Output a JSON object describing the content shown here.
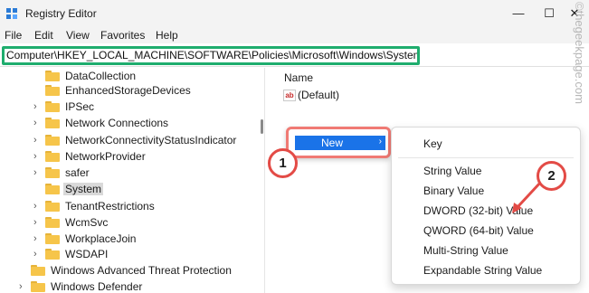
{
  "window": {
    "title": "Registry Editor",
    "controls": {
      "minimize": "—",
      "maximize": "☐",
      "close": "✕"
    }
  },
  "menu": [
    "File",
    "Edit",
    "View",
    "Favorites",
    "Help"
  ],
  "address": {
    "path": "Computer\\HKEY_LOCAL_MACHINE\\SOFTWARE\\Policies\\Microsoft\\Windows\\System"
  },
  "tree": {
    "items": [
      {
        "label": "DataCollection",
        "expandable": false
      },
      {
        "label": "EnhancedStorageDevices",
        "expandable": false
      },
      {
        "label": "IPSec",
        "expandable": true
      },
      {
        "label": "Network Connections",
        "expandable": true
      },
      {
        "label": "NetworkConnectivityStatusIndicator",
        "expandable": true
      },
      {
        "label": "NetworkProvider",
        "expandable": true
      },
      {
        "label": "safer",
        "expandable": true
      },
      {
        "label": "System",
        "expandable": false,
        "selected": true
      },
      {
        "label": "TenantRestrictions",
        "expandable": true
      },
      {
        "label": "WcmSvc",
        "expandable": true
      },
      {
        "label": "WorkplaceJoin",
        "expandable": true
      },
      {
        "label": "WSDAPI",
        "expandable": true
      }
    ],
    "parent_items": [
      {
        "label": "Windows Advanced Threat Protection",
        "expandable": false
      },
      {
        "label": "Windows Defender",
        "expandable": true
      }
    ]
  },
  "values_pane": {
    "column_name": "Name",
    "rows": [
      {
        "icon": "string-value-icon",
        "icon_text": "ab",
        "name": "(Default)"
      }
    ]
  },
  "context_menu": {
    "new_item": {
      "label": "New",
      "arrow": "›"
    },
    "submenu": {
      "key": "Key",
      "items": [
        "String Value",
        "Binary Value",
        "DWORD (32-bit) Value",
        "QWORD (64-bit) Value",
        "Multi-String Value",
        "Expandable String Value"
      ]
    }
  },
  "callouts": [
    "1",
    "2"
  ],
  "watermark": "©thegeekpage.com",
  "colors": {
    "address_highlight": "#1fad6e",
    "callout_red": "#e34b46",
    "menu_highlight": "#1a73e8",
    "folder_yellow": "#f6c54a"
  }
}
